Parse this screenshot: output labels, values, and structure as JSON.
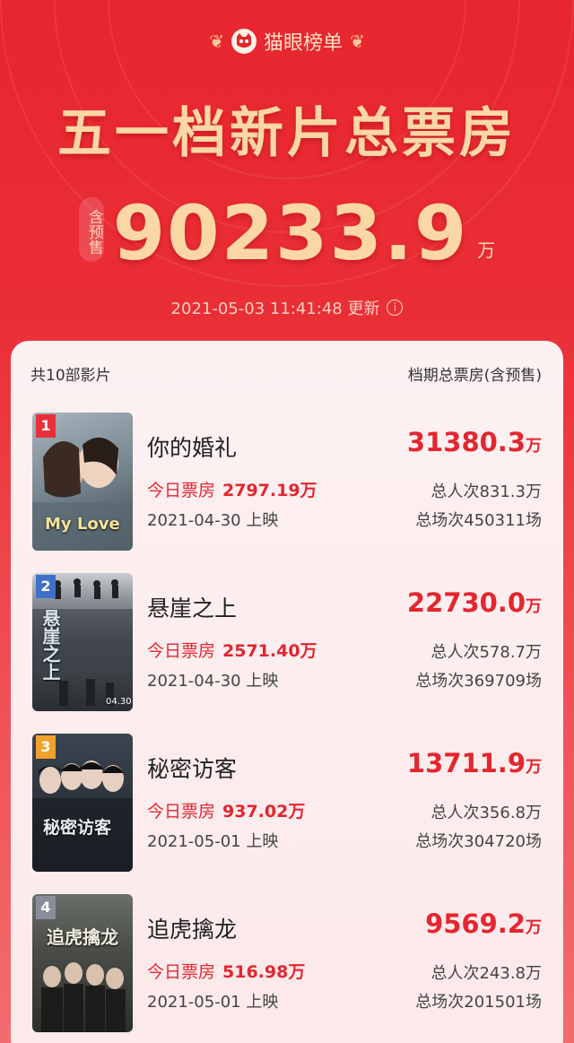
{
  "header": {
    "brand": "猫眼榜单",
    "title": "五一档新片总票房",
    "presale_tag": "含预售",
    "total": "90233.9",
    "unit": "万",
    "updated": "2021-05-03 11:41:48 更新"
  },
  "list": {
    "count_label": "共10部影片",
    "total_label": "档期总票房(含预售)"
  },
  "movies": [
    {
      "rank": "1",
      "name": "你的婚礼",
      "box": "31380.3",
      "unit": "万",
      "today_label": "今日票房",
      "today": "2797.19万",
      "release": "2021-04-30 上映",
      "viewers": "总人次831.3万",
      "sessions": "总场次450311场",
      "poster_text": "My Love",
      "rank_color": "#e8303a"
    },
    {
      "rank": "2",
      "name": "悬崖之上",
      "box": "22730.0",
      "unit": "万",
      "today_label": "今日票房",
      "today": "2571.40万",
      "release": "2021-04-30 上映",
      "viewers": "总人次578.7万",
      "sessions": "总场次369709场",
      "poster_text": "悬崖之上",
      "rank_color": "#3f6fc8"
    },
    {
      "rank": "3",
      "name": "秘密访客",
      "box": "13711.9",
      "unit": "万",
      "today_label": "今日票房",
      "today": "937.02万",
      "release": "2021-05-01 上映",
      "viewers": "总人次356.8万",
      "sessions": "总场次304720场",
      "poster_text": "秘密访客",
      "rank_color": "#f0a22c"
    },
    {
      "rank": "4",
      "name": "追虎擒龙",
      "box": "9569.2",
      "unit": "万",
      "today_label": "今日票房",
      "today": "516.98万",
      "release": "2021-05-01 上映",
      "viewers": "总人次243.8万",
      "sessions": "总场次201501场",
      "poster_text": "追虎擒龙",
      "rank_color": "#888d99"
    }
  ]
}
